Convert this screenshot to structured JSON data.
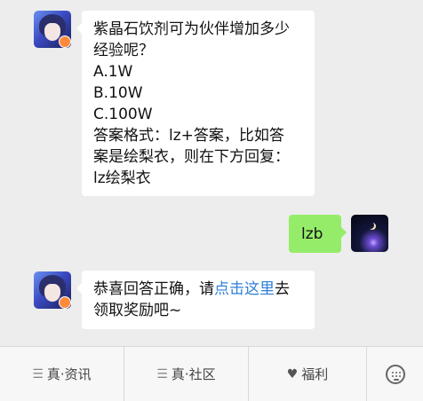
{
  "messages": [
    {
      "sender": "bot",
      "lines": [
        "紫晶石饮剂可为伙伴增加多少",
        "经验呢？",
        "A.1W",
        "B.10W",
        "C.100W",
        "答案格式：lz+答案，比如答",
        "案是绘梨衣，则在下方回复：",
        "lz绘梨衣"
      ]
    },
    {
      "sender": "user",
      "text": "lzb"
    },
    {
      "sender": "bot",
      "line1_prefix": "恭喜回答正确，请",
      "line1_link": "点击这里",
      "line1_suffix": "去",
      "line2": "领取奖励吧~"
    }
  ],
  "menu": {
    "items": [
      {
        "icon": "menu-icon",
        "label": "真·资讯"
      },
      {
        "icon": "menu-icon",
        "label": "真·社区"
      },
      {
        "icon": "heart-icon",
        "label": "福利"
      }
    ],
    "keyboard_icon": "keyboard-icon"
  },
  "colors": {
    "background": "#ededed",
    "user_bubble": "#95ec69",
    "link": "#2f7fd8"
  }
}
